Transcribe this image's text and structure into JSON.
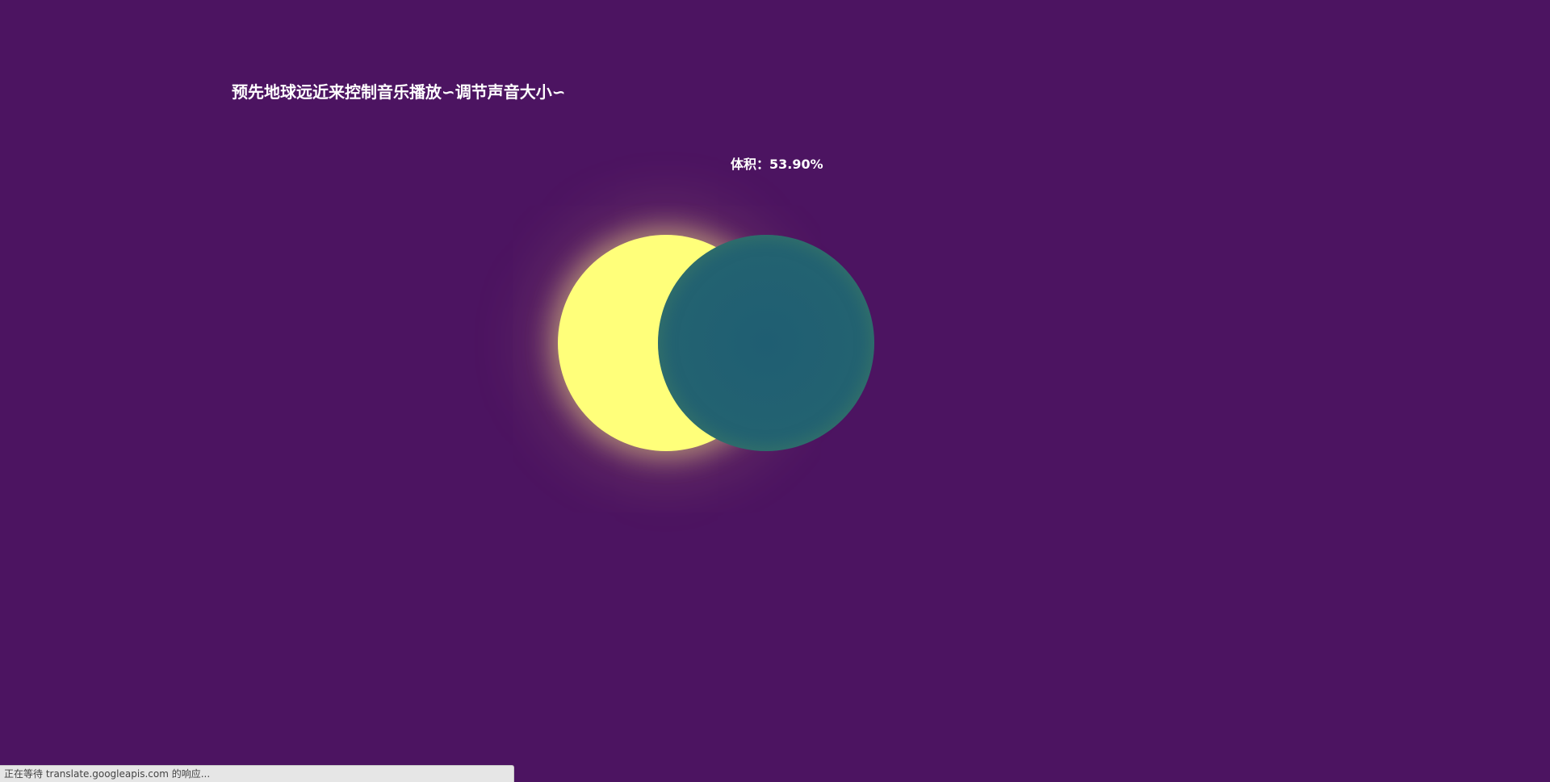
{
  "page": {
    "instruction": "预先地球远近来控制音乐播放∽调节声音大小∽",
    "volume_label": "体积：",
    "volume_value": "53.90%",
    "volume_fraction": 0.539
  },
  "scene": {
    "sun_icon": "sun-circle",
    "earth_icon": "earth-circle",
    "colors": {
      "background": "#4c1461",
      "sun": "#ffff7a",
      "earth": "#236271"
    }
  },
  "browser": {
    "status_text": "正在等待 translate.googleapis.com 的响应..."
  }
}
